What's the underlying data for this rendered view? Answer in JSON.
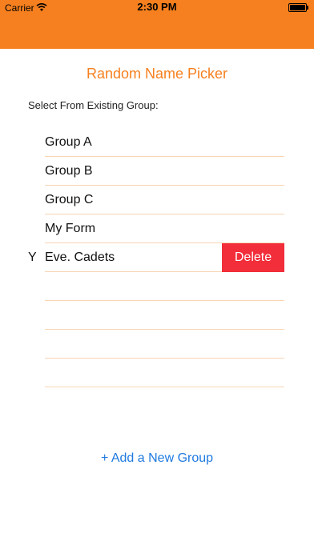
{
  "status_bar": {
    "carrier": "Carrier",
    "time": "2:30 PM"
  },
  "header": {
    "title": "Random Name Picker",
    "section_label": "Select From Existing Group:"
  },
  "groups": [
    {
      "label": "Group A"
    },
    {
      "label": "Group B"
    },
    {
      "label": "Group C"
    },
    {
      "label": "My Form"
    },
    {
      "label": "Eve. Cadets",
      "clipped_prefix": "Y"
    },
    {
      "label": ""
    },
    {
      "label": ""
    },
    {
      "label": ""
    },
    {
      "label": ""
    }
  ],
  "swipe_action": {
    "label": "Delete",
    "color": "#f12e3a"
  },
  "footer": {
    "add_label": "+ Add a New Group"
  },
  "colors": {
    "accent": "#f6801f",
    "link": "#1f7ae0",
    "separator": "#f8d5b4"
  },
  "icons": [
    "wifi-icon",
    "battery-icon"
  ]
}
